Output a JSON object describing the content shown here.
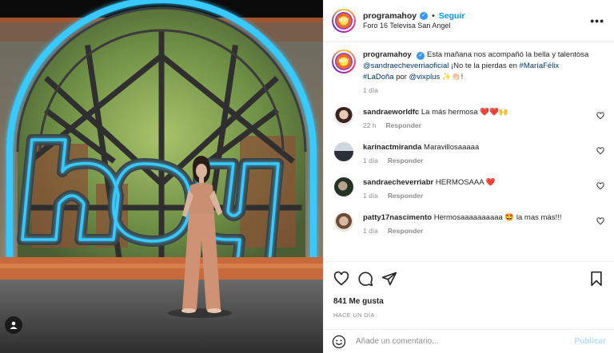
{
  "post": {
    "account": "programahoy",
    "follow_label": "Seguir",
    "separator": "•",
    "location": "Foro 16 Televisa San Angel",
    "more_label": "•••"
  },
  "caption": {
    "username": "programahoy",
    "text_1": "Esta mañana nos acompañó la bella y talentosa",
    "mention_1": "@sandraecheverriaoficial",
    "text_2": "¡No te la pierdas en",
    "hashtag_1": "#MaríaFélix",
    "hashtag_2": "#LaDoña",
    "text_3": "por",
    "mention_2": "@vixplus",
    "emojis": "✨👏🏻!",
    "time": "1 día"
  },
  "comments": [
    {
      "username": "sandraeworldfc",
      "text": "La más hermosa ❤️❤️🙌",
      "time": "22 h",
      "reply": "Responder"
    },
    {
      "username": "karinactmiranda",
      "text": "Maravillosaaaaa",
      "time": "1 día",
      "reply": "Responder"
    },
    {
      "username": "sandraecheverriabr",
      "text": "HERMOSAAA ❤️",
      "time": "1 día",
      "reply": "Responder"
    },
    {
      "username": "patty17nascimento",
      "text": "Hermosaaaaaaaaaa 🤩 la mas más!!!",
      "time": "1 día",
      "reply": "Responder"
    }
  ],
  "engagement": {
    "likes": "841 Me gusta",
    "date": "HACE UN DÍA"
  },
  "composer": {
    "placeholder": "Añade un comentario...",
    "post_label": "Publicar"
  },
  "media": {
    "sign_text": "hoy"
  },
  "colors": {
    "accent": "#0095f6",
    "verified": "#3897f0",
    "neon": "#37c9ff",
    "heart": "#ed4956"
  }
}
